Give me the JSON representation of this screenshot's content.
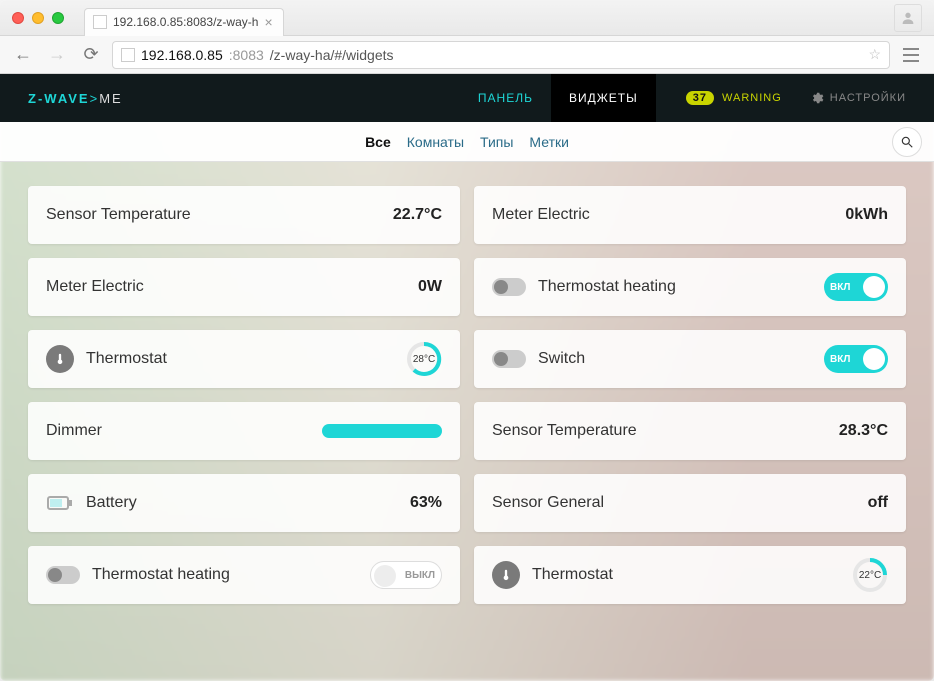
{
  "browser": {
    "tab_title": "192.168.0.85:8083/z-way-h",
    "addr_host": "192.168.0.85",
    "addr_port": ":8083",
    "addr_path": "/z-way-ha/#/widgets"
  },
  "header": {
    "logo_brand": "Z-WAVE",
    "logo_suffix": "ME",
    "nav_panel": "ПАНЕЛЬ",
    "nav_widgets": "ВИДЖЕТЫ",
    "warning_count": "37",
    "warning_label": "WARNING",
    "settings_label": "НАСТРОЙКИ"
  },
  "filters": {
    "all": "Все",
    "rooms": "Комнаты",
    "types": "Типы",
    "tags": "Метки"
  },
  "widgets": {
    "l0": {
      "label": "Sensor Temperature",
      "value": "22.7°C"
    },
    "r0": {
      "label": "Meter Electric",
      "value": "0kWh"
    },
    "l1": {
      "label": "Meter Electric",
      "value": "0W"
    },
    "r1": {
      "label": "Thermostat heating",
      "toggle_on_label": "ВКЛ"
    },
    "l2": {
      "label": "Thermostat",
      "dial": "28°C"
    },
    "r2": {
      "label": "Switch",
      "toggle_on_label": "ВКЛ"
    },
    "l3": {
      "label": "Dimmer"
    },
    "r3": {
      "label": "Sensor Temperature",
      "value": "28.3°C"
    },
    "l4": {
      "label": "Battery",
      "value": "63%"
    },
    "r4": {
      "label": "Sensor General",
      "value": "off"
    },
    "l5": {
      "label": "Thermostat heating",
      "toggle_off_label": "ВЫКЛ"
    },
    "r5": {
      "label": "Thermostat",
      "dial": "22°C"
    }
  }
}
